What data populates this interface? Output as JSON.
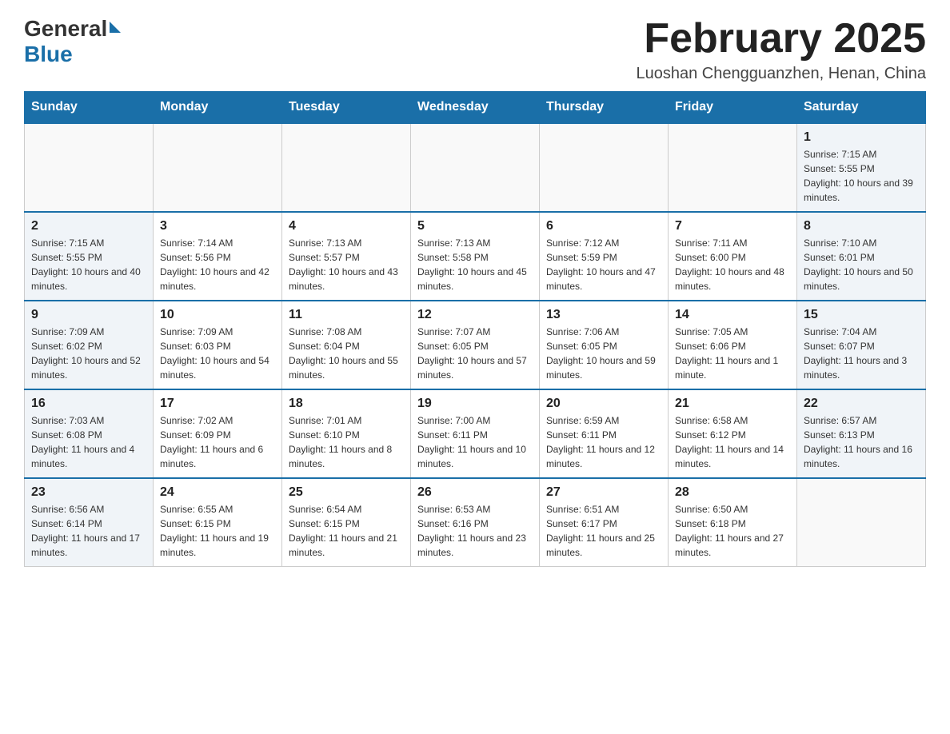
{
  "header": {
    "logo_general": "General",
    "logo_blue": "Blue",
    "month_title": "February 2025",
    "location": "Luoshan Chengguanzhen, Henan, China"
  },
  "days_of_week": [
    "Sunday",
    "Monday",
    "Tuesday",
    "Wednesday",
    "Thursday",
    "Friday",
    "Saturday"
  ],
  "weeks": [
    {
      "days": [
        {
          "num": "",
          "sunrise": "",
          "sunset": "",
          "daylight": "",
          "empty": true
        },
        {
          "num": "",
          "sunrise": "",
          "sunset": "",
          "daylight": "",
          "empty": true
        },
        {
          "num": "",
          "sunrise": "",
          "sunset": "",
          "daylight": "",
          "empty": true
        },
        {
          "num": "",
          "sunrise": "",
          "sunset": "",
          "daylight": "",
          "empty": true
        },
        {
          "num": "",
          "sunrise": "",
          "sunset": "",
          "daylight": "",
          "empty": true
        },
        {
          "num": "",
          "sunrise": "",
          "sunset": "",
          "daylight": "",
          "empty": true
        },
        {
          "num": "1",
          "sunrise": "Sunrise: 7:15 AM",
          "sunset": "Sunset: 5:55 PM",
          "daylight": "Daylight: 10 hours and 39 minutes.",
          "empty": false
        }
      ]
    },
    {
      "days": [
        {
          "num": "2",
          "sunrise": "Sunrise: 7:15 AM",
          "sunset": "Sunset: 5:55 PM",
          "daylight": "Daylight: 10 hours and 40 minutes.",
          "empty": false
        },
        {
          "num": "3",
          "sunrise": "Sunrise: 7:14 AM",
          "sunset": "Sunset: 5:56 PM",
          "daylight": "Daylight: 10 hours and 42 minutes.",
          "empty": false
        },
        {
          "num": "4",
          "sunrise": "Sunrise: 7:13 AM",
          "sunset": "Sunset: 5:57 PM",
          "daylight": "Daylight: 10 hours and 43 minutes.",
          "empty": false
        },
        {
          "num": "5",
          "sunrise": "Sunrise: 7:13 AM",
          "sunset": "Sunset: 5:58 PM",
          "daylight": "Daylight: 10 hours and 45 minutes.",
          "empty": false
        },
        {
          "num": "6",
          "sunrise": "Sunrise: 7:12 AM",
          "sunset": "Sunset: 5:59 PM",
          "daylight": "Daylight: 10 hours and 47 minutes.",
          "empty": false
        },
        {
          "num": "7",
          "sunrise": "Sunrise: 7:11 AM",
          "sunset": "Sunset: 6:00 PM",
          "daylight": "Daylight: 10 hours and 48 minutes.",
          "empty": false
        },
        {
          "num": "8",
          "sunrise": "Sunrise: 7:10 AM",
          "sunset": "Sunset: 6:01 PM",
          "daylight": "Daylight: 10 hours and 50 minutes.",
          "empty": false
        }
      ]
    },
    {
      "days": [
        {
          "num": "9",
          "sunrise": "Sunrise: 7:09 AM",
          "sunset": "Sunset: 6:02 PM",
          "daylight": "Daylight: 10 hours and 52 minutes.",
          "empty": false
        },
        {
          "num": "10",
          "sunrise": "Sunrise: 7:09 AM",
          "sunset": "Sunset: 6:03 PM",
          "daylight": "Daylight: 10 hours and 54 minutes.",
          "empty": false
        },
        {
          "num": "11",
          "sunrise": "Sunrise: 7:08 AM",
          "sunset": "Sunset: 6:04 PM",
          "daylight": "Daylight: 10 hours and 55 minutes.",
          "empty": false
        },
        {
          "num": "12",
          "sunrise": "Sunrise: 7:07 AM",
          "sunset": "Sunset: 6:05 PM",
          "daylight": "Daylight: 10 hours and 57 minutes.",
          "empty": false
        },
        {
          "num": "13",
          "sunrise": "Sunrise: 7:06 AM",
          "sunset": "Sunset: 6:05 PM",
          "daylight": "Daylight: 10 hours and 59 minutes.",
          "empty": false
        },
        {
          "num": "14",
          "sunrise": "Sunrise: 7:05 AM",
          "sunset": "Sunset: 6:06 PM",
          "daylight": "Daylight: 11 hours and 1 minute.",
          "empty": false
        },
        {
          "num": "15",
          "sunrise": "Sunrise: 7:04 AM",
          "sunset": "Sunset: 6:07 PM",
          "daylight": "Daylight: 11 hours and 3 minutes.",
          "empty": false
        }
      ]
    },
    {
      "days": [
        {
          "num": "16",
          "sunrise": "Sunrise: 7:03 AM",
          "sunset": "Sunset: 6:08 PM",
          "daylight": "Daylight: 11 hours and 4 minutes.",
          "empty": false
        },
        {
          "num": "17",
          "sunrise": "Sunrise: 7:02 AM",
          "sunset": "Sunset: 6:09 PM",
          "daylight": "Daylight: 11 hours and 6 minutes.",
          "empty": false
        },
        {
          "num": "18",
          "sunrise": "Sunrise: 7:01 AM",
          "sunset": "Sunset: 6:10 PM",
          "daylight": "Daylight: 11 hours and 8 minutes.",
          "empty": false
        },
        {
          "num": "19",
          "sunrise": "Sunrise: 7:00 AM",
          "sunset": "Sunset: 6:11 PM",
          "daylight": "Daylight: 11 hours and 10 minutes.",
          "empty": false
        },
        {
          "num": "20",
          "sunrise": "Sunrise: 6:59 AM",
          "sunset": "Sunset: 6:11 PM",
          "daylight": "Daylight: 11 hours and 12 minutes.",
          "empty": false
        },
        {
          "num": "21",
          "sunrise": "Sunrise: 6:58 AM",
          "sunset": "Sunset: 6:12 PM",
          "daylight": "Daylight: 11 hours and 14 minutes.",
          "empty": false
        },
        {
          "num": "22",
          "sunrise": "Sunrise: 6:57 AM",
          "sunset": "Sunset: 6:13 PM",
          "daylight": "Daylight: 11 hours and 16 minutes.",
          "empty": false
        }
      ]
    },
    {
      "days": [
        {
          "num": "23",
          "sunrise": "Sunrise: 6:56 AM",
          "sunset": "Sunset: 6:14 PM",
          "daylight": "Daylight: 11 hours and 17 minutes.",
          "empty": false
        },
        {
          "num": "24",
          "sunrise": "Sunrise: 6:55 AM",
          "sunset": "Sunset: 6:15 PM",
          "daylight": "Daylight: 11 hours and 19 minutes.",
          "empty": false
        },
        {
          "num": "25",
          "sunrise": "Sunrise: 6:54 AM",
          "sunset": "Sunset: 6:15 PM",
          "daylight": "Daylight: 11 hours and 21 minutes.",
          "empty": false
        },
        {
          "num": "26",
          "sunrise": "Sunrise: 6:53 AM",
          "sunset": "Sunset: 6:16 PM",
          "daylight": "Daylight: 11 hours and 23 minutes.",
          "empty": false
        },
        {
          "num": "27",
          "sunrise": "Sunrise: 6:51 AM",
          "sunset": "Sunset: 6:17 PM",
          "daylight": "Daylight: 11 hours and 25 minutes.",
          "empty": false
        },
        {
          "num": "28",
          "sunrise": "Sunrise: 6:50 AM",
          "sunset": "Sunset: 6:18 PM",
          "daylight": "Daylight: 11 hours and 27 minutes.",
          "empty": false
        },
        {
          "num": "",
          "sunrise": "",
          "sunset": "",
          "daylight": "",
          "empty": true
        }
      ]
    }
  ]
}
